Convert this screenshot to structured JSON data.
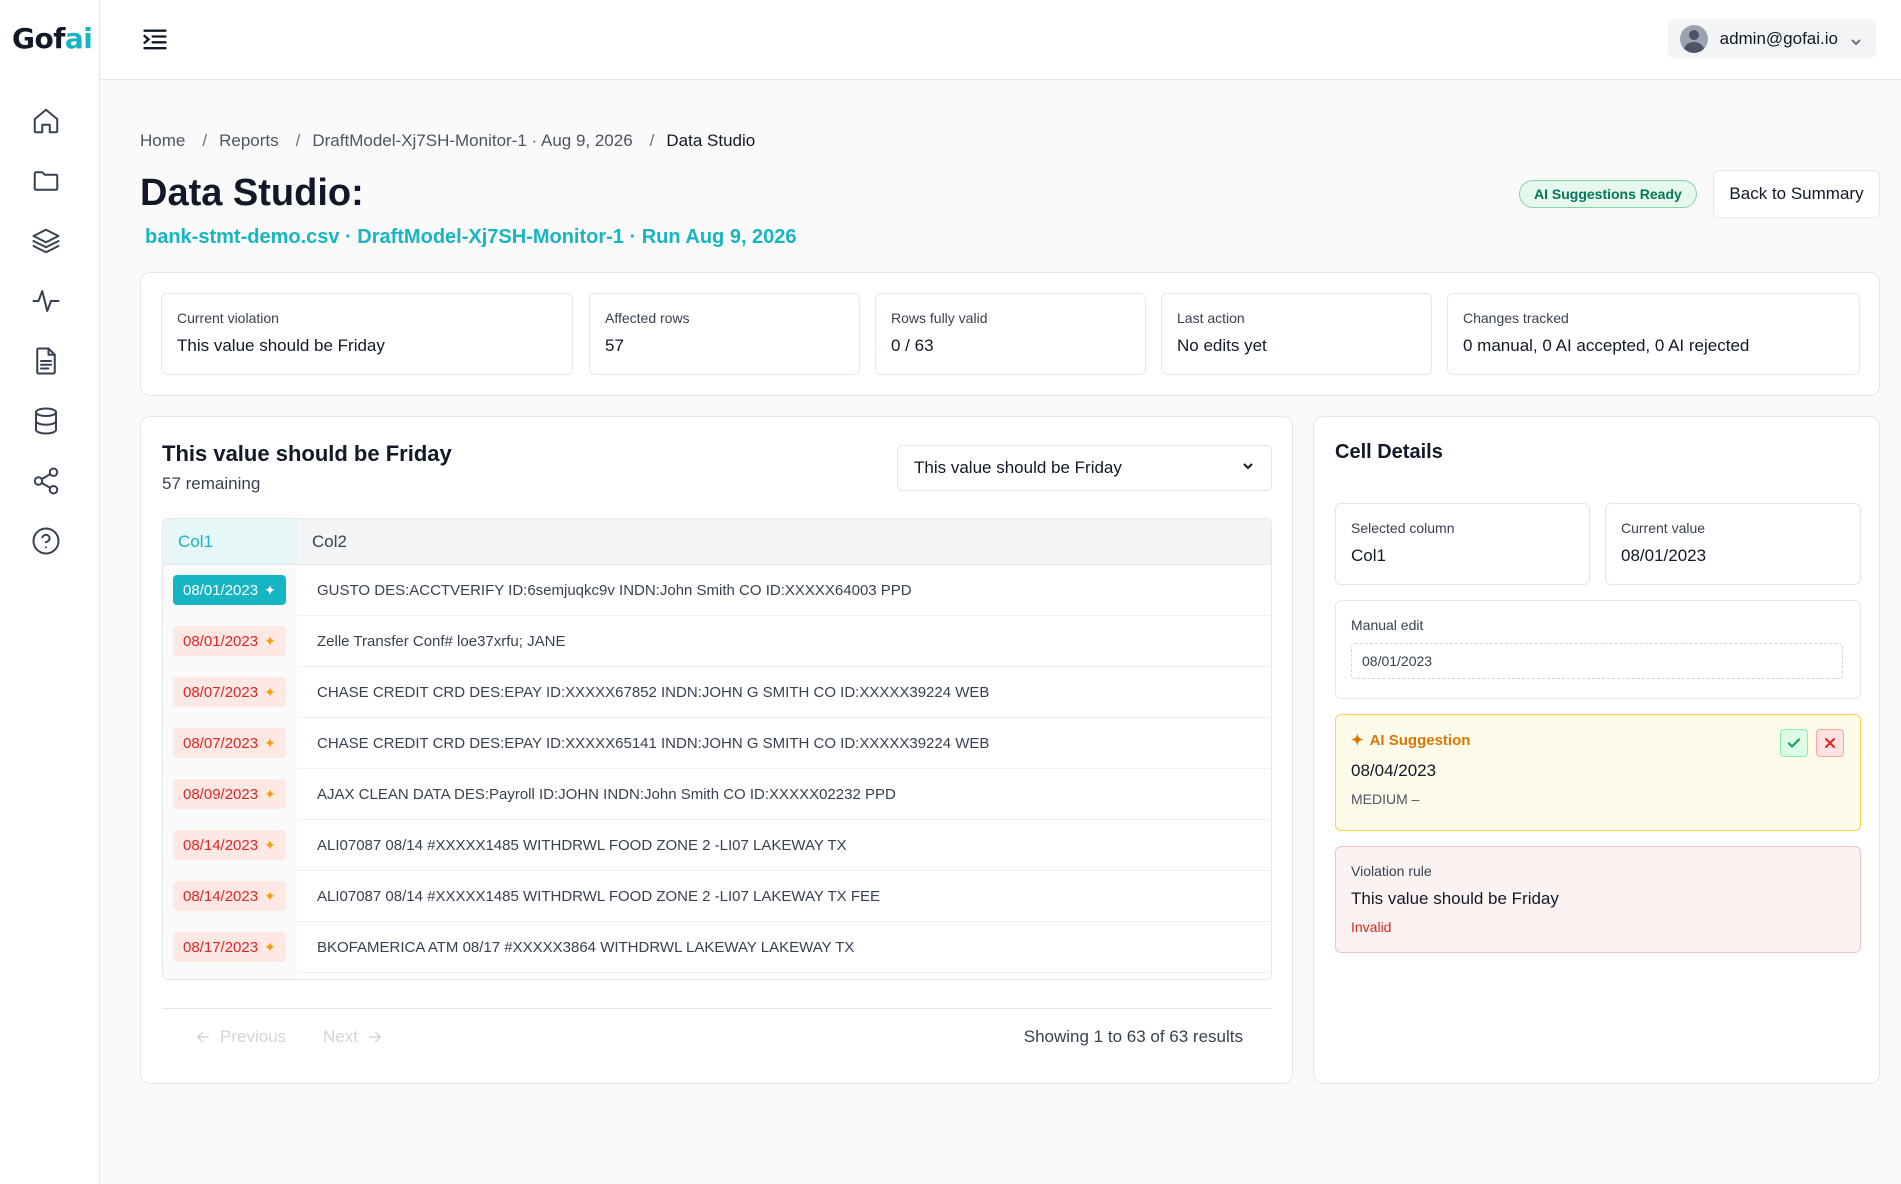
{
  "brand": {
    "logo_prefix": "Gof",
    "logo_suffix": "ai"
  },
  "sidebar": {
    "items": [
      {
        "icon": "home-icon"
      },
      {
        "icon": "folder-icon"
      },
      {
        "icon": "layers-icon"
      },
      {
        "icon": "activity-icon"
      },
      {
        "icon": "document-icon"
      },
      {
        "icon": "database-icon"
      },
      {
        "icon": "share-icon"
      },
      {
        "icon": "help-icon"
      }
    ]
  },
  "topbar": {
    "user_email": "admin@gofai.io"
  },
  "breadcrumb": {
    "home": "Home",
    "reports": "Reports",
    "model": "DraftModel-Xj7SH-Monitor-1 · Aug 9, 2026",
    "current": "Data Studio"
  },
  "page": {
    "title": "Data Studio:",
    "subtitle": "bank-stmt-demo.csv · DraftModel-Xj7SH-Monitor-1 · Run Aug 9, 2026",
    "ai_badge": "AI Suggestions Ready",
    "back_button": "Back to Summary"
  },
  "stats": {
    "current_violation": {
      "label": "Current violation",
      "value": "This value should be Friday"
    },
    "affected_rows": {
      "label": "Affected rows",
      "value": "57"
    },
    "rows_valid": {
      "label": "Rows fully valid",
      "value": "0 / 63"
    },
    "last_action": {
      "label": "Last action",
      "value": "No edits yet"
    },
    "changes": {
      "label": "Changes tracked",
      "value": "0 manual, 0 AI accepted, 0 AI rejected"
    }
  },
  "table_panel": {
    "title": "This value should be Friday",
    "remaining": "57 remaining",
    "rule_select": "This value should be Friday",
    "columns": [
      "Col1",
      "Col2"
    ],
    "rows": [
      {
        "col1": "08/01/2023",
        "col2": "GUSTO DES:ACCTVERIFY ID:6semjuqkc9v INDN:John Smith CO ID:XXXXX64003 PPD",
        "selected": true
      },
      {
        "col1": "08/01/2023",
        "col2": "Zelle Transfer Conf# loe37xrfu; JANE",
        "selected": false
      },
      {
        "col1": "08/07/2023",
        "col2": "CHASE CREDIT CRD DES:EPAY ID:XXXXX67852 INDN:JOHN G SMITH CO ID:XXXXX39224 WEB",
        "selected": false
      },
      {
        "col1": "08/07/2023",
        "col2": "CHASE CREDIT CRD DES:EPAY ID:XXXXX65141 INDN:JOHN G SMITH CO ID:XXXXX39224 WEB",
        "selected": false
      },
      {
        "col1": "08/09/2023",
        "col2": "AJAX CLEAN DATA DES:Payroll ID:JOHN INDN:John Smith CO ID:XXXXX02232 PPD",
        "selected": false
      },
      {
        "col1": "08/14/2023",
        "col2": "ALI07087 08/14 #XXXXX1485 WITHDRWL FOOD ZONE 2 -LI07 LAKEWAY TX",
        "selected": false
      },
      {
        "col1": "08/14/2023",
        "col2": "ALI07087 08/14 #XXXXX1485 WITHDRWL FOOD ZONE 2 -LI07 LAKEWAY TX FEE",
        "selected": false
      },
      {
        "col1": "08/17/2023",
        "col2": "BKOFAMERICA ATM 08/17 #XXXXX3864 WITHDRWL LAKEWAY LAKEWAY TX",
        "selected": false
      }
    ],
    "pager": {
      "prev": "Previous",
      "next": "Next",
      "info": "Showing 1 to 63 of 63 results"
    }
  },
  "details": {
    "title": "Cell Details",
    "selected_column": {
      "label": "Selected column",
      "value": "Col1"
    },
    "current_value": {
      "label": "Current value",
      "value": "08/01/2023"
    },
    "manual_edit": {
      "label": "Manual edit",
      "value": "08/01/2023"
    },
    "ai_suggestion": {
      "label": "AI Suggestion",
      "value": "08/04/2023",
      "confidence": "MEDIUM –"
    },
    "violation_rule": {
      "label": "Violation rule",
      "value": "This value should be Friday",
      "status": "Invalid"
    }
  },
  "colors": {
    "accent": "#16b5c3",
    "invalid": "#dc2626",
    "warning": "#f59e0b",
    "success": "#16a34a"
  }
}
